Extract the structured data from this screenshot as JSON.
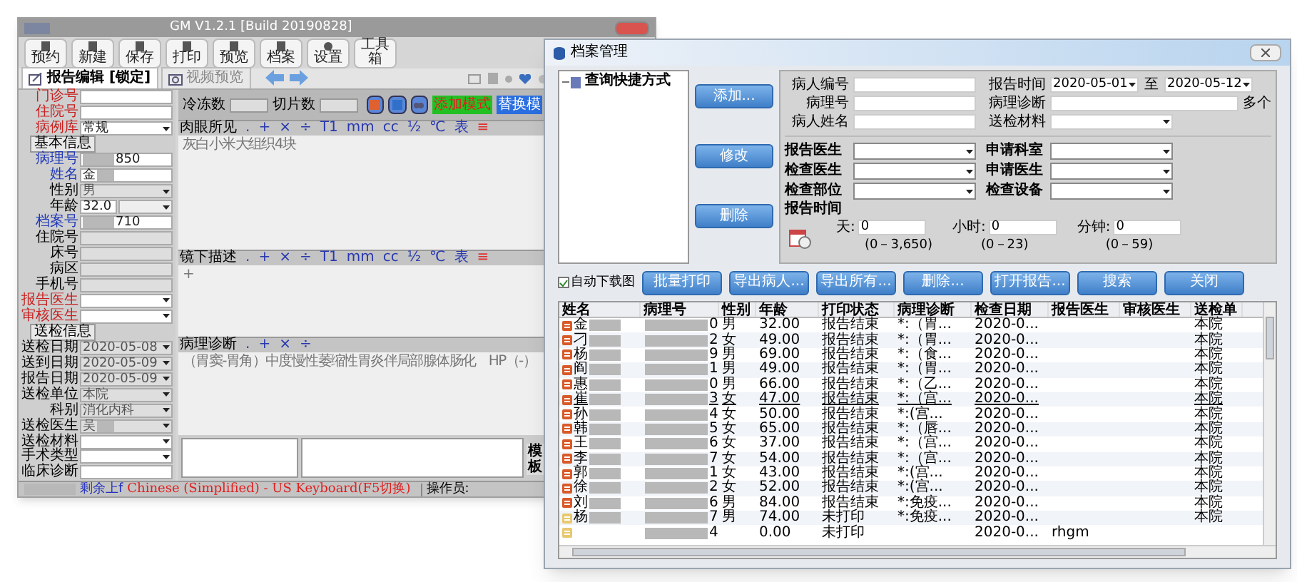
{
  "main_window": {
    "title": "GM V1.2.1 [Build 20190828]",
    "toolbar": [
      "预约",
      "新建",
      "保存",
      "打印",
      "预览",
      "档案",
      "设置",
      "工具箱"
    ],
    "tabs": [
      {
        "label": "报告编辑 [锁定]",
        "selected": true
      },
      {
        "label": "视频预览",
        "selected": false
      }
    ],
    "form": [
      {
        "kind": "field",
        "label": "门诊号",
        "color": "#c82020"
      },
      {
        "kind": "field",
        "label": "住院号",
        "color": "#c82020"
      },
      {
        "kind": "select",
        "label": "病例库",
        "color": "#c82020",
        "value": "常规"
      },
      {
        "kind": "group",
        "label": "基本信息"
      },
      {
        "kind": "field",
        "label": "病理号",
        "color": "#2038b8",
        "value": "850",
        "redacted": true
      },
      {
        "kind": "field",
        "label": "姓名",
        "color": "#2038b8",
        "value": "金",
        "redacted": true
      },
      {
        "kind": "select",
        "label": "性别",
        "value": "男",
        "disabled": true
      },
      {
        "kind": "age",
        "label": "年龄",
        "value": "32.0"
      },
      {
        "kind": "field",
        "label": "档案号",
        "color": "#2038b8",
        "value": "710",
        "redacted": true
      },
      {
        "kind": "field",
        "label": "住院号",
        "disabled": true
      },
      {
        "kind": "field",
        "label": "床号",
        "disabled": true
      },
      {
        "kind": "field",
        "label": "病区",
        "disabled": true
      },
      {
        "kind": "field",
        "label": "手机号",
        "disabled": true
      },
      {
        "kind": "select",
        "label": "报告医生",
        "color": "#c82020"
      },
      {
        "kind": "select",
        "label": "审核医生",
        "color": "#c82020"
      },
      {
        "kind": "group",
        "label": "送检信息"
      },
      {
        "kind": "date",
        "label": "送检日期",
        "value": "2020-05-08",
        "disabled": true
      },
      {
        "kind": "date",
        "label": "送到日期",
        "value": "2020-05-09",
        "disabled": true
      },
      {
        "kind": "date",
        "label": "报告日期",
        "value": "2020-05-09",
        "disabled": true
      },
      {
        "kind": "select",
        "label": "送检单位",
        "value": "本院",
        "disabled": true
      },
      {
        "kind": "select",
        "label": "科别",
        "value": "消化内科",
        "disabled": true
      },
      {
        "kind": "select",
        "label": "送检医生",
        "value": "吴",
        "redacted": true,
        "disabled": true
      },
      {
        "kind": "select",
        "label": "送检材料"
      },
      {
        "kind": "select",
        "label": "手术类型"
      },
      {
        "kind": "field",
        "label": "临床诊断"
      }
    ],
    "counts": [
      {
        "label": "冷冻数"
      },
      {
        "label": "切片数"
      }
    ],
    "modes": [
      {
        "label": "添加模式",
        "selected": true
      },
      {
        "label": "替换模",
        "selected": false
      }
    ],
    "sections": [
      {
        "title": "肉眼所见",
        "tools": [
          ".",
          "+",
          "×",
          "÷",
          "T1",
          "mm",
          "cc",
          "½",
          "℃",
          "表"
        ],
        "alert_tool": "≡",
        "text": "灰白小米大组织4块"
      },
      {
        "title": "镜下描述",
        "tools": [
          ".",
          "+",
          "×",
          "÷",
          "T1",
          "mm",
          "cc",
          "½",
          "℃",
          "表"
        ],
        "alert_tool": "≡",
        "text": "+"
      },
      {
        "title": "病理诊断",
        "tools": [
          ".",
          "+",
          "×",
          "÷"
        ],
        "text": "（胃窦-胃角）中度慢性萎缩性胃炎伴局部腺体肠化　HP（-）"
      }
    ],
    "side_tab": "模板",
    "status_bar": {
      "remaining": "剩余上f",
      "ime": "Chinese (Simplified) - US Keyboard(F5切换)",
      "operator": "操作员:"
    }
  },
  "archive_window": {
    "title": "档案管理",
    "tree": [
      {
        "label": "查询快捷方式"
      }
    ],
    "side_buttons": [
      "添加...",
      "修改",
      "删除"
    ],
    "query_rows": [
      [
        {
          "label": "病人编号",
          "kind": "text"
        },
        {
          "label": "报告时间",
          "kind": "date",
          "value": "2020-05-01"
        },
        {
          "label": "至",
          "kind": "date",
          "value": "2020-05-12"
        }
      ],
      [
        {
          "label": "病理号",
          "kind": "text"
        },
        {
          "label": "病理诊断",
          "kind": "wide",
          "suffix": "多个"
        }
      ],
      [
        {
          "label": "病人姓名",
          "kind": "text"
        },
        {
          "label": "送检材料",
          "kind": "select"
        }
      ]
    ],
    "criteria": [
      [
        {
          "label": "报告医生"
        },
        {
          "label": "申请科室"
        }
      ],
      [
        {
          "label": "检查医生"
        },
        {
          "label": "申请医生"
        }
      ],
      [
        {
          "label": "检查部位"
        },
        {
          "label": "检查设备"
        }
      ]
    ],
    "time_title": "报告时间",
    "time_fields": [
      {
        "label": "天:",
        "value": "0",
        "range": "(0－3,650)"
      },
      {
        "label": "小时:",
        "value": "0",
        "range": "(0－23)"
      },
      {
        "label": "分钟:",
        "value": "0",
        "range": "(0－59)"
      }
    ],
    "auto_download": {
      "label": "自动下载图",
      "checked": true
    },
    "actions": [
      "批量打印",
      "导出病人...",
      "导出所有...",
      "删除...",
      "打开报告...",
      "搜索",
      "关闭"
    ],
    "table": {
      "columns": [
        "姓名",
        "病理号",
        "性别",
        "年龄",
        "打印状态",
        "病理诊断",
        "检查日期",
        "报告医生",
        "审核医生",
        "送检单"
      ],
      "rows": [
        {
          "kind": "finished",
          "selected": false,
          "cells": [
            "金",
            "0",
            "男",
            "32.00",
            "报告结束",
            "*:（胃...",
            "2020-0...",
            "",
            "",
            "本院"
          ]
        },
        {
          "kind": "finished",
          "selected": false,
          "cells": [
            "刁",
            "2",
            "女",
            "49.00",
            "报告结束",
            "*:（胃...",
            "2020-0...",
            "",
            "",
            "本院"
          ]
        },
        {
          "kind": "finished",
          "selected": false,
          "cells": [
            "杨",
            "9",
            "男",
            "69.00",
            "报告结束",
            "*:（食...",
            "2020-0...",
            "",
            "",
            "本院"
          ]
        },
        {
          "kind": "finished",
          "selected": false,
          "cells": [
            "阎",
            "1",
            "男",
            "49.00",
            "报告结束",
            "*:（胃...",
            "2020-0...",
            "",
            "",
            "本院"
          ]
        },
        {
          "kind": "finished",
          "selected": false,
          "cells": [
            "惠",
            "0",
            "男",
            "66.00",
            "报告结束",
            "*:（乙...",
            "2020-0...",
            "",
            "",
            "本院"
          ]
        },
        {
          "kind": "finished",
          "selected": true,
          "cells": [
            "崔",
            "3",
            "女",
            "47.00",
            "报告结束",
            "*:（宫...",
            "2020-0...",
            "",
            "",
            "本院"
          ]
        },
        {
          "kind": "finished",
          "selected": false,
          "cells": [
            "孙",
            "4",
            "女",
            "50.00",
            "报告结束",
            "*:(宫...",
            "2020-0...",
            "",
            "",
            "本院"
          ]
        },
        {
          "kind": "finished",
          "selected": false,
          "cells": [
            "韩",
            "5",
            "女",
            "65.00",
            "报告结束",
            "*:（唇...",
            "2020-0...",
            "",
            "",
            "本院"
          ]
        },
        {
          "kind": "finished",
          "selected": false,
          "cells": [
            "王",
            "6",
            "女",
            "37.00",
            "报告结束",
            "*:（宫...",
            "2020-0...",
            "",
            "",
            "本院"
          ]
        },
        {
          "kind": "finished",
          "selected": false,
          "cells": [
            "李",
            "7",
            "女",
            "54.00",
            "报告结束",
            "*:（宫...",
            "2020-0...",
            "",
            "",
            "本院"
          ]
        },
        {
          "kind": "finished",
          "selected": false,
          "cells": [
            "郭",
            "1",
            "女",
            "43.00",
            "报告结束",
            "*:(宫...",
            "2020-0...",
            "",
            "",
            "本院"
          ]
        },
        {
          "kind": "finished",
          "selected": false,
          "cells": [
            "徐",
            "2",
            "女",
            "52.00",
            "报告结束",
            "*:(宫...",
            "2020-0...",
            "",
            "",
            "本院"
          ]
        },
        {
          "kind": "finished",
          "selected": false,
          "cells": [
            "刘",
            "6",
            "男",
            "84.00",
            "报告结束",
            "*:免疫...",
            "2020-0...",
            "",
            "",
            "本院"
          ]
        },
        {
          "kind": "unprinted",
          "selected": false,
          "cells": [
            "杨",
            "7",
            "男",
            "74.00",
            "未打印",
            "*:免疫...",
            "2020-0...",
            "",
            "",
            "本院"
          ]
        },
        {
          "kind": "unprinted",
          "selected": false,
          "cells": [
            "",
            "4",
            "",
            "0.00",
            "未打印",
            "",
            "2020-0...",
            "rhgm",
            "",
            ""
          ]
        }
      ]
    }
  }
}
